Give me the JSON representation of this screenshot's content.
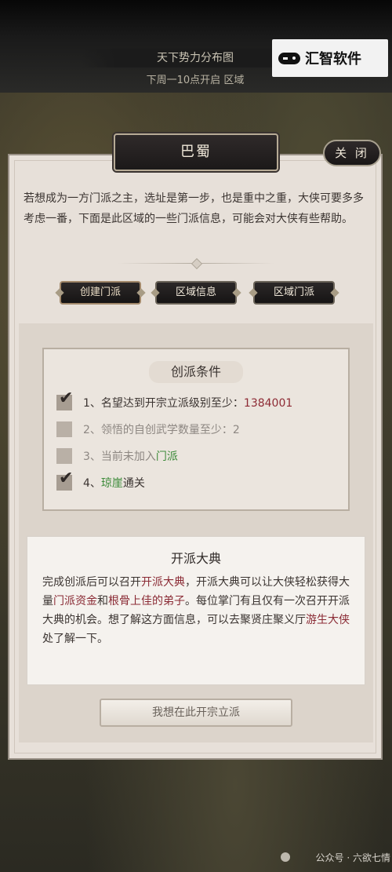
{
  "top": {
    "title": "天下势力分布图",
    "subtitle_pre": "下周一10点开启",
    "subtitle_mid": "",
    "subtitle_post": "区域"
  },
  "watermark": {
    "text": "汇智软件",
    "icon": "gamepad-icon"
  },
  "panel": {
    "title": "巴蜀",
    "close_label": "关  闭",
    "intro": "若想成为一方门派之主，选址是第一步，也是重中之重，大侠可要多多考虑一番，下面是此区域的一些门派信息，可能会对大侠有些帮助。",
    "tabs": [
      {
        "label": "创建门派",
        "active": true
      },
      {
        "label": "区域信息",
        "active": false
      },
      {
        "label": "区域门派",
        "active": false
      }
    ]
  },
  "conditions": {
    "title": "创派条件",
    "items": [
      {
        "checked": true,
        "prefix": "1、名望达到开宗立派级别至少：",
        "highlight": "1384001",
        "suffix": ""
      },
      {
        "checked": false,
        "prefix": "2、领悟的自创武学数量至少：2",
        "highlight": "",
        "suffix": ""
      },
      {
        "checked": false,
        "prefix": "3、当前未加入",
        "highlight": "门派",
        "suffix": ""
      },
      {
        "checked": true,
        "prefix": "4、",
        "highlight": "琼崖",
        "suffix": "通关"
      }
    ]
  },
  "ceremony": {
    "title": "开派大典",
    "p1": "完成创派后可以召开",
    "r1": "开派大典",
    "p2": "，开派大典可以让大侠轻松获得大量",
    "r2": "门派资金",
    "p3": "和",
    "r3": "根骨上佳的弟子",
    "p4": "。每位掌门有且仅有一次召开开派大典的机会。想了解这方面信息，可以去聚贤庄聚义厅",
    "r4": "游生大侠",
    "p5": "处了解一下。"
  },
  "action": {
    "label": "我想在此开宗立派"
  },
  "footer": {
    "credit": "公众号 · 六欲七情"
  },
  "colors": {
    "accent_red": "#8d2a34",
    "accent_green": "#3d8b3a",
    "panel_bg": "#e7e0d9"
  }
}
